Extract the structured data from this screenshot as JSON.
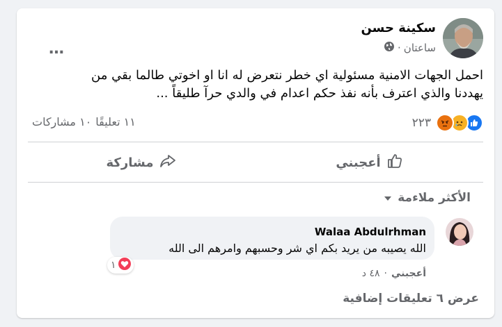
{
  "post": {
    "author": "سكينة حسن",
    "time": "ساعتان",
    "separator": "·",
    "text_line1": "احمل الجهات الامنية مسئولية اي خطر نتعرض له انا او اخوتي طالما بقي من",
    "text_line2": "يهددنا والذي اعترف بأنه  نفذ حكم اعدام في  والدي حرآ طليقاً ...",
    "more_icon": "…",
    "reaction_count": "٢٢٣",
    "comments_count": "١١ تعليقًا",
    "shares_count": "١٠ مشاركات",
    "reactions": [
      "like-icon",
      "sad-icon",
      "angry-icon"
    ]
  },
  "actions": {
    "like_label": "أعجبني",
    "share_label": "مشاركة"
  },
  "sort": {
    "label": "الأكثر ملاءمة"
  },
  "comment": {
    "author": "Walaa Abdulrhman",
    "text": "الله يصيبه من يريد بكم اي شر وحسبهم وامرهم الى الله",
    "like_label": "أعجبني",
    "time": "٤٨ د",
    "separator": "·",
    "reaction_count": "١"
  },
  "view_more": {
    "label": "عرض ٦ تعليقات إضافية"
  },
  "colors": {
    "background": "#f0f2f5",
    "card": "#ffffff",
    "text": "#050505",
    "muted": "#65676b",
    "like_blue": "#1877f2",
    "love_red": "#f33e58"
  }
}
